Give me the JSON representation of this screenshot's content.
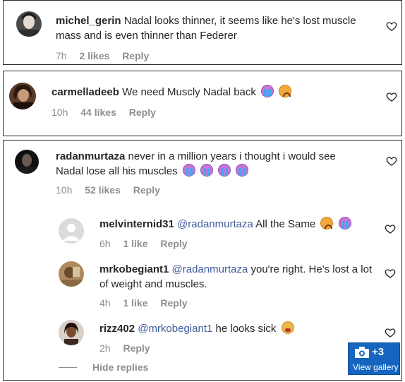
{
  "comments": [
    {
      "username": "michel_gerin",
      "text": "Nadal looks thinner, it seems like he's lost muscle mass and is even thinner than Federer",
      "time": "7h",
      "likes": "2 likes",
      "reply": "Reply"
    },
    {
      "username": "carmelladeeb",
      "text": "We need Muscly Nadal back",
      "time": "10h",
      "likes": "44 likes",
      "reply": "Reply"
    },
    {
      "username": "radanmurtaza",
      "text": "never in a million years i thought i would see Nadal lose all his muscles",
      "time": "10h",
      "likes": "52 likes",
      "reply": "Reply",
      "replies": [
        {
          "username": "melvinternid31",
          "mention": "@radanmurtaza",
          "text": "All the Same",
          "time": "6h",
          "likes": "1 like",
          "reply": "Reply"
        },
        {
          "username": "mrkobegiant1",
          "mention": "@radanmurtaza",
          "text": "you're right. He's lost a lot of weight and muscles.",
          "time": "4h",
          "likes": "1 like",
          "reply": "Reply"
        },
        {
          "username": "rizz402",
          "mention": "@mrkobegiant1",
          "text": "he looks sick",
          "time": "2h",
          "reply": "Reply"
        }
      ],
      "hide_replies": "Hide replies"
    }
  ],
  "gallery": {
    "count": "+3",
    "label": "View gallery"
  },
  "icons": {
    "heart": "heart-outline-icon",
    "camera": "camera-icon"
  },
  "colors": {
    "mention": "#3e5d9c",
    "meta": "#8e8e8e",
    "gallery_bg": "#1565c0"
  }
}
